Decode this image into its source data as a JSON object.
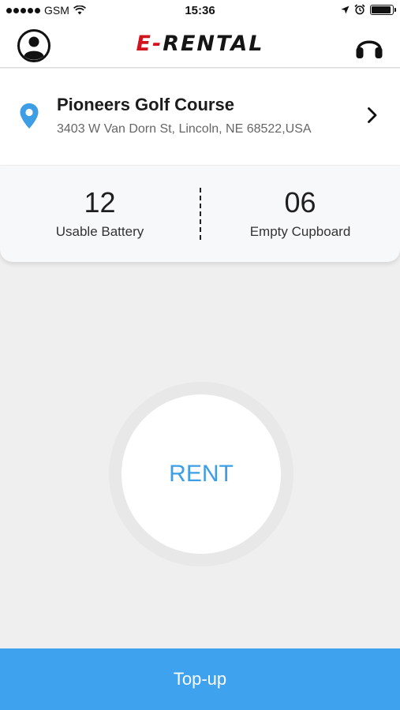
{
  "status_bar": {
    "carrier": "GSM",
    "time": "15:36",
    "signal_icon": "signal-dots-icon",
    "wifi_icon": "wifi-icon",
    "location_icon": "location-arrow-icon",
    "alarm_icon": "alarm-icon",
    "battery_icon": "battery-icon",
    "battery_level": 0.92
  },
  "header": {
    "logo_accent": "E-",
    "logo_main": "RENTAL",
    "profile_icon": "user-avatar-icon",
    "support_icon": "headphones-icon"
  },
  "location": {
    "icon": "map-pin-icon",
    "name": "Pioneers Golf Course",
    "address": "3403 W Van Dorn St, Lincoln, NE 68522,USA",
    "arrow_icon": "chevron-right-icon"
  },
  "stats": {
    "battery_value": "12",
    "battery_label": "Usable Battery",
    "cupboard_value": "06",
    "cupboard_label": "Empty Cupboard"
  },
  "actions": {
    "rent_label": "RENT",
    "topup_label": "Top-up"
  },
  "colors": {
    "accent": "#3ea2ef",
    "rent_text": "#3d9ee6",
    "logo_red": "#d0131d",
    "background": "#efefef"
  }
}
